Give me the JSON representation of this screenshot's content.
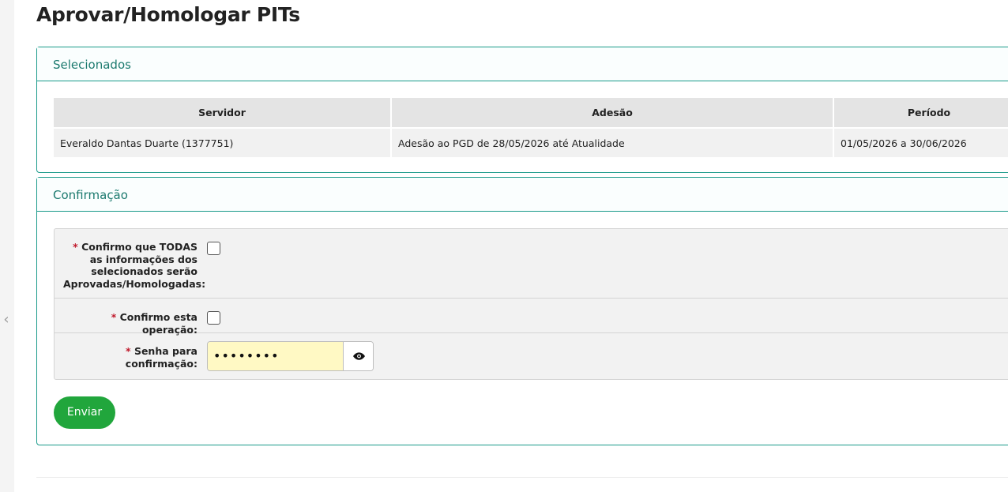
{
  "page": {
    "title": "Aprovar/Homologar PITs"
  },
  "selected_panel": {
    "title": "Selecionados",
    "columns": [
      "Servidor",
      "Adesão",
      "Período"
    ],
    "rows": [
      [
        "Everaldo Dantas Duarte (1377751)",
        "Adesão ao PGD de 28/05/2026 até Atualidade",
        "01/05/2026 a 30/06/2026"
      ]
    ]
  },
  "confirm_panel": {
    "title": "Confirmação",
    "required_mark": "*",
    "confirm_all_label": "Confirmo que TODAS as informações dos selecionados serão Aprovadas/Homologadas:",
    "confirm_all_checked": false,
    "confirm_op_label": "Confirmo esta operação:",
    "confirm_op_checked": false,
    "password_label": "Senha para confirmação:",
    "password_masked": "••••••••",
    "submit_label": "Enviar"
  },
  "colors": {
    "accent": "#1a9a8a",
    "submit": "#21a63c",
    "required": "#c0192b",
    "autofill": "#fff9c4"
  },
  "icons": {
    "rail": "chevron-left-icon",
    "password_toggle": "eye-icon"
  }
}
